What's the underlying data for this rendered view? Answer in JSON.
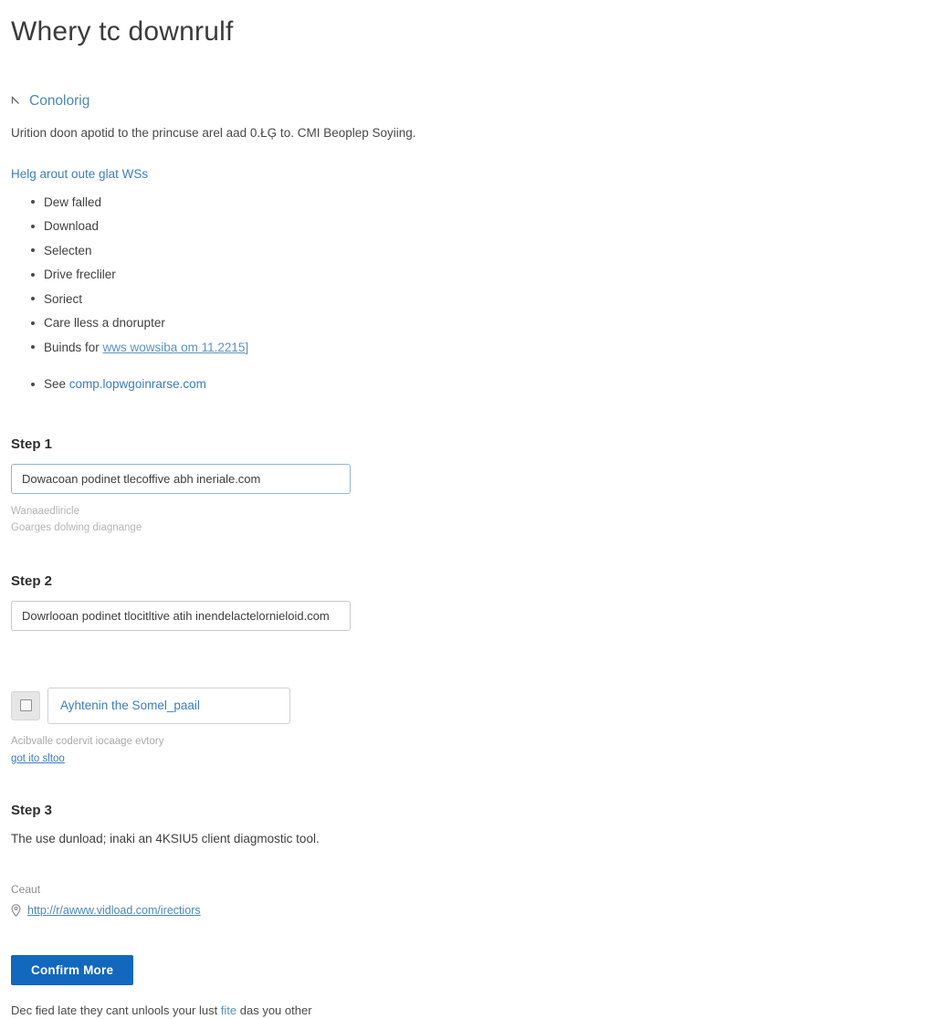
{
  "page": {
    "title": "Whery tc downrulf"
  },
  "section": {
    "caret_icon": "chevron-collapse-icon",
    "heading": "Conolorig",
    "intro": "Urition doon apotid to the princuse arel aad 0.ŁĢ to. CMI Beoplep Soyiing."
  },
  "help": {
    "link_label": "Helg arout oute glat WSs"
  },
  "bullets": [
    {
      "text": "Dew falled"
    },
    {
      "text": "Download"
    },
    {
      "text": "Selecten"
    },
    {
      "text": "Drive frecliler"
    },
    {
      "text": "Soriect"
    },
    {
      "text": "Care lless a dnorupter"
    },
    {
      "prefix": "Buinds for ",
      "link": "wws wowsiba om 11.2215]",
      "link_style": "underline"
    },
    {
      "prefix": "See ",
      "link": "comp.lopwgoinrarse.com",
      "link_style": "plain",
      "spaced": true
    }
  ],
  "step1": {
    "title": "Step 1",
    "input_value": "Dowacoan podinet tlecoffive abh ineriale.com",
    "input_placeholder": "Dowacoan podinet tlecoffive abh ineriale.com",
    "helper_line1": "Wanaaedliricle",
    "helper_line2": "Goarges dolwing diagnange"
  },
  "step2": {
    "title": "Step 2",
    "input_value": "Dowrlooan podinet tlocitltive atih inendelactelornieloid.com",
    "input_placeholder": "Dowrlooan podinet tlocitltive atih inendelactelornieloid.com"
  },
  "checkrow": {
    "checkbox_name": "checkbox-toggle",
    "input_value": "Ayhtenin the Somel_paail",
    "input_placeholder": "Ayhtenin the Somel_paail",
    "helper": "Acibvalle codervit iocaage evtory",
    "helper_link": "got ito sltoo"
  },
  "step3": {
    "title": "Step 3",
    "text": "The use dunload; inaki an 4KSIU5 client diagmostic tool."
  },
  "contact": {
    "label": "Ceaut",
    "pin_icon": "location-pin-icon",
    "link": "http://r/awww.vidload.com/irectiors"
  },
  "footer": {
    "button_label": "Confirm More",
    "note_prefix": "Dec fied late they cant unlools your lust ",
    "note_link": "fite",
    "note_suffix": " das you other"
  },
  "colors": {
    "accent_blue": "#1268bd",
    "link_blue": "#3c7dbf",
    "heading_blue": "#4a87b8",
    "focus_border": "#8fb8d4",
    "helper_gray": "#b4b4b4"
  }
}
